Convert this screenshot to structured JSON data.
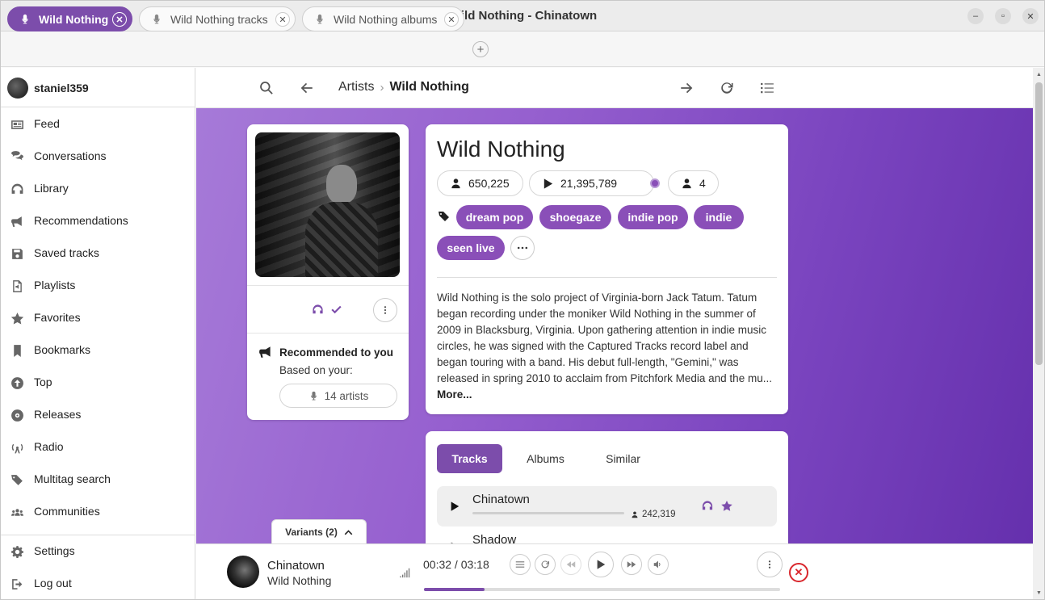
{
  "window": {
    "title": "Wild Nothing - Chinatown"
  },
  "tabs": [
    {
      "label": "Wild Nothing",
      "active": true
    },
    {
      "label": "Wild Nothing tracks",
      "active": false
    },
    {
      "label": "Wild Nothing albums",
      "active": false
    }
  ],
  "user": {
    "name": "staniel359"
  },
  "sidebar": {
    "items": [
      {
        "label": "Feed",
        "icon": "newspaper-icon"
      },
      {
        "label": "Conversations",
        "icon": "chat-icon"
      },
      {
        "label": "Library",
        "icon": "headphones-icon"
      },
      {
        "label": "Recommendations",
        "icon": "bullhorn-icon"
      },
      {
        "label": "Saved tracks",
        "icon": "floppy-icon"
      },
      {
        "label": "Playlists",
        "icon": "file-audio-icon"
      },
      {
        "label": "Favorites",
        "icon": "star-icon"
      },
      {
        "label": "Bookmarks",
        "icon": "bookmark-icon"
      },
      {
        "label": "Top",
        "icon": "arrow-up-circle-icon"
      },
      {
        "label": "Releases",
        "icon": "vinyl-icon"
      },
      {
        "label": "Radio",
        "icon": "radio-icon"
      },
      {
        "label": "Multitag search",
        "icon": "tags-icon"
      },
      {
        "label": "Communities",
        "icon": "users-icon"
      }
    ],
    "bottom": [
      {
        "label": "Settings",
        "icon": "gear-icon"
      },
      {
        "label": "Log out",
        "icon": "logout-icon"
      }
    ]
  },
  "breadcrumb": {
    "parent": "Artists",
    "current": "Wild Nothing"
  },
  "artist": {
    "name": "Wild Nothing",
    "listeners": "650,225",
    "plays": "21,395,789",
    "followers": "4",
    "tags": [
      "dream pop",
      "shoegaze",
      "indie pop",
      "indie",
      "seen live"
    ],
    "bio_text": "Wild Nothing is the solo project of Virginia-born Jack Tatum. Tatum began recording under the moniker Wild Nothing in the summer of 2009 in Blacksburg, Virginia. Upon gathering attention in indie music circles, he was signed with the Captured Tracks record label and began touring with a band. His debut full-length, \"Gemini,\" was released in spring 2010 to acclaim from Pitchfork Media and the mu...",
    "bio_more": "More..."
  },
  "recommendation": {
    "title": "Recommended to you",
    "subtitle": "Based on your:",
    "artists_count": "14 artists"
  },
  "content_tabs": [
    {
      "label": "Tracks",
      "active": true
    },
    {
      "label": "Albums",
      "active": false
    },
    {
      "label": "Similar",
      "active": false
    }
  ],
  "tracks": [
    {
      "title": "Chinatown",
      "listeners": "242,319",
      "progress": 0
    },
    {
      "title": "Shadow"
    }
  ],
  "variants": {
    "label": "Variants (2)"
  },
  "player": {
    "title": "Chinatown",
    "artist": "Wild Nothing",
    "time": "00:32 / 03:18",
    "progress": 0.17
  },
  "colors": {
    "accent": "#7c4dab",
    "tag": "#8a4fb8",
    "close": "#d9262c"
  }
}
